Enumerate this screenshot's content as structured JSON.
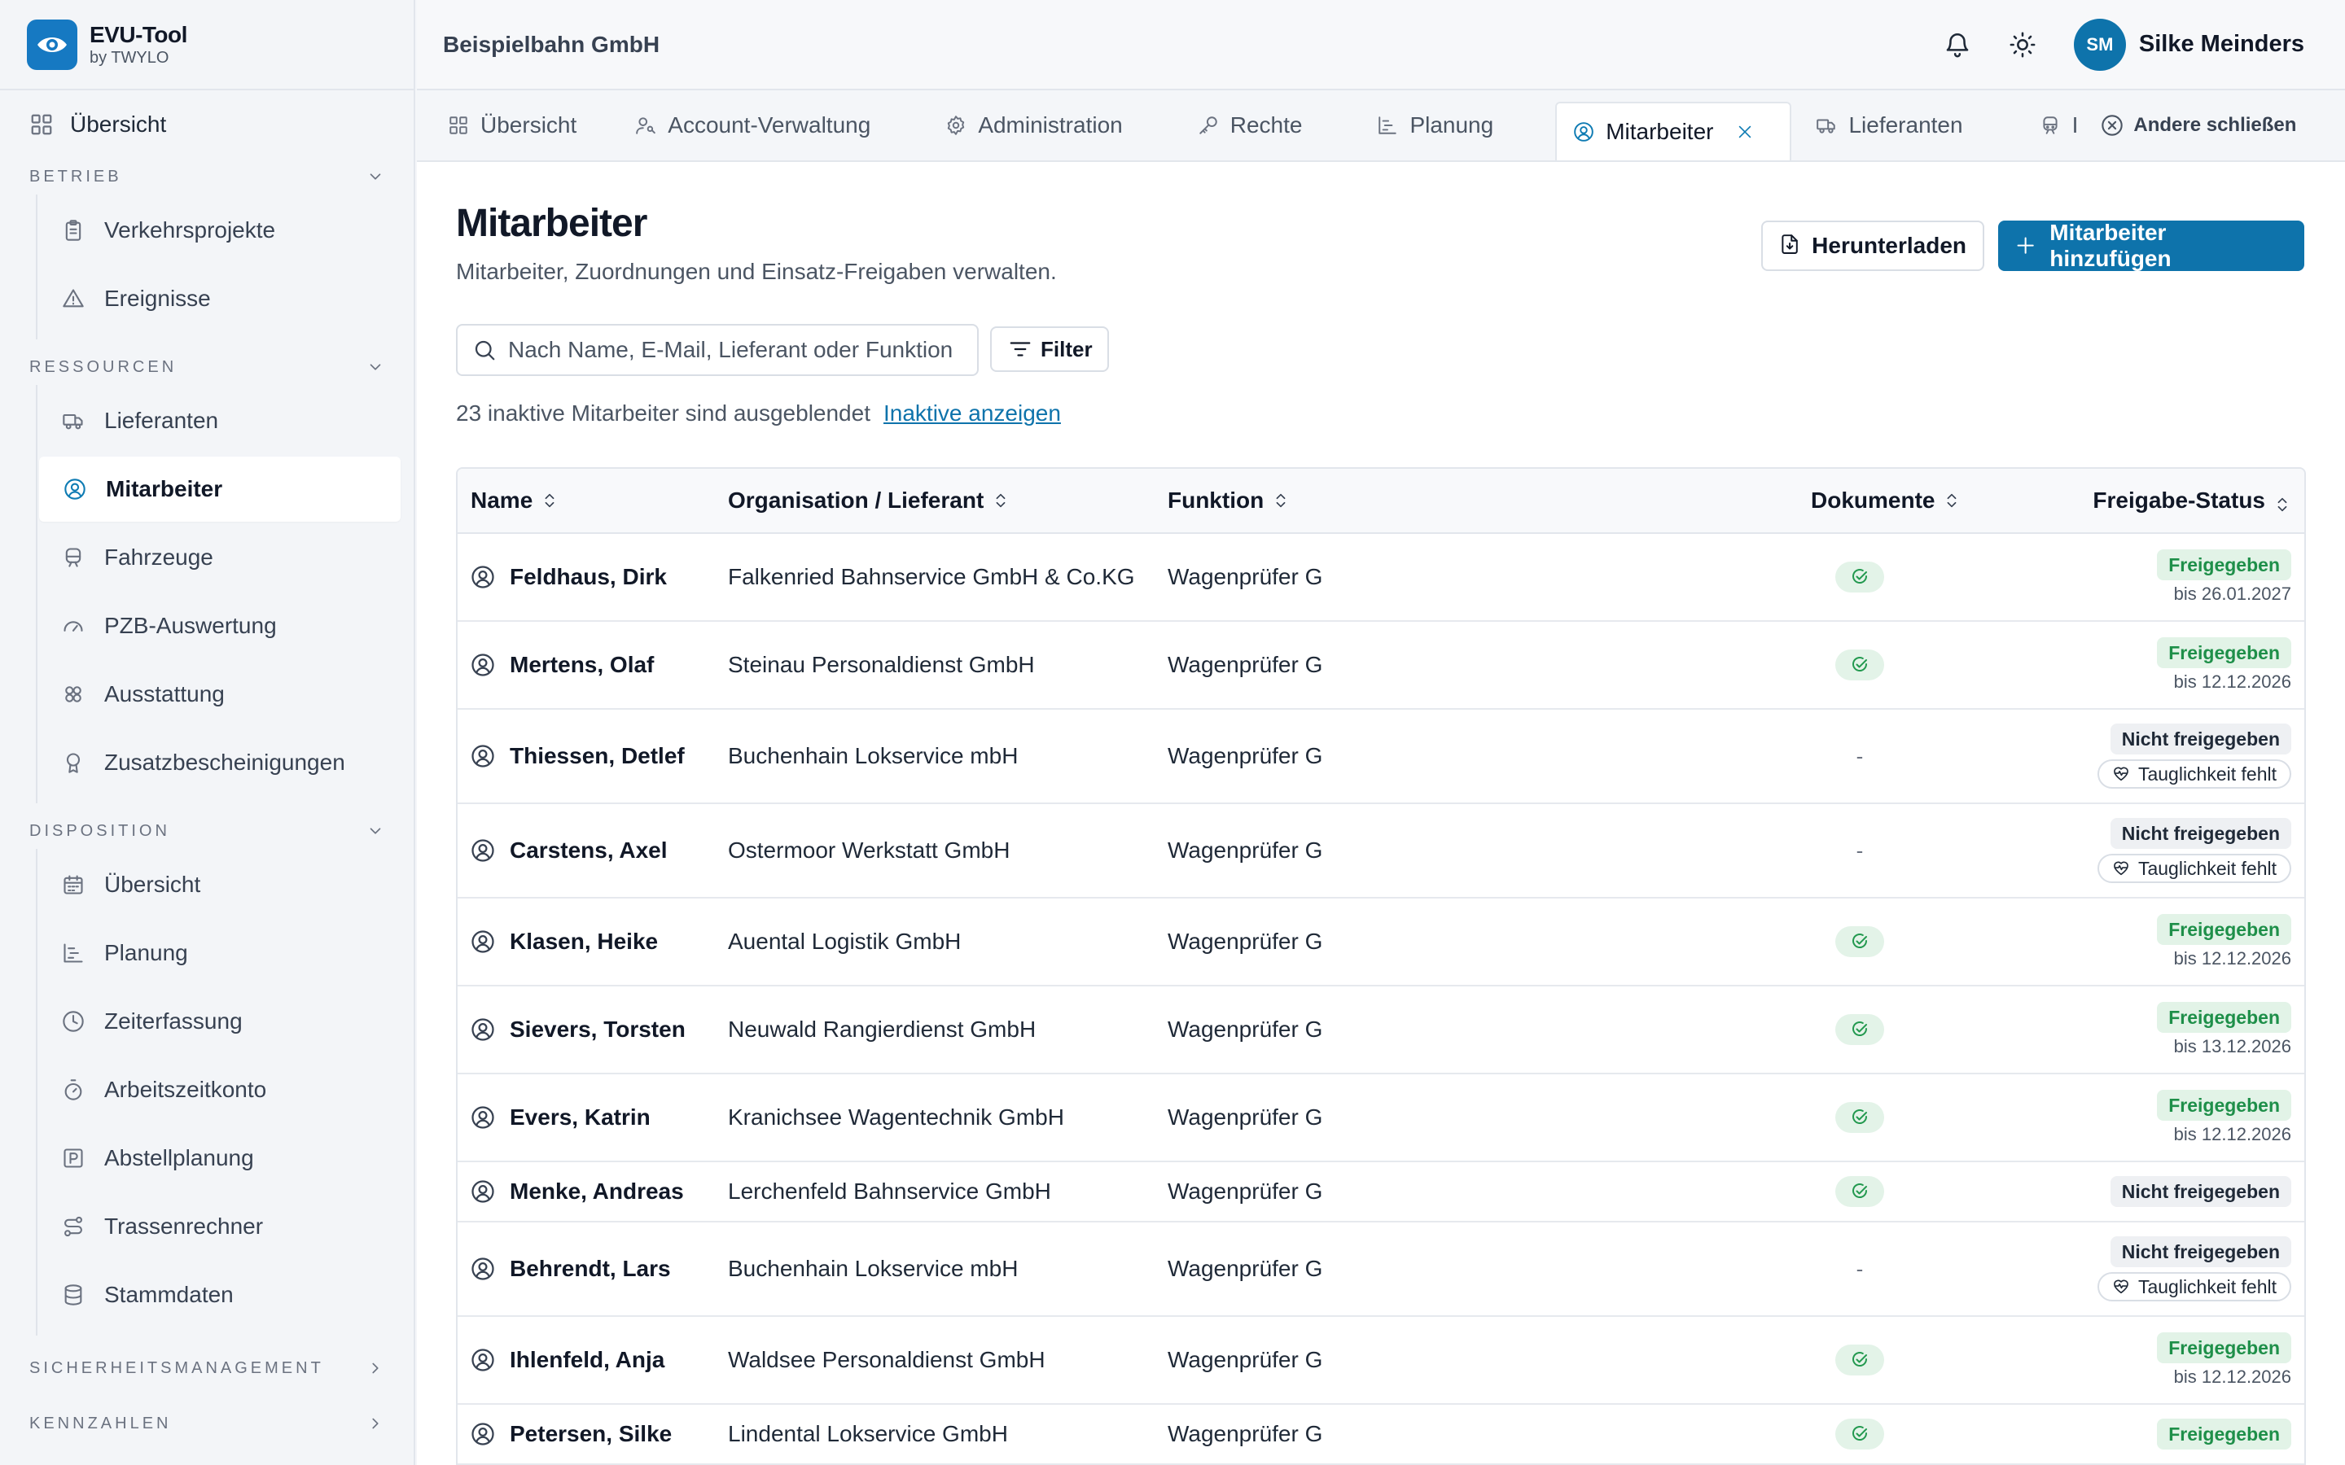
{
  "brand": {
    "name": "EVU-Tool",
    "sub": "by TWYLO"
  },
  "header": {
    "company": "Beispielbahn GmbH",
    "user_initials": "SM",
    "user_name": "Silke Meinders"
  },
  "sidebar": {
    "top": {
      "label": "Übersicht"
    },
    "sections": [
      {
        "title": "Betrieb",
        "items": [
          {
            "label": "Verkehrsprojekte",
            "icon": "clipboard-icon"
          },
          {
            "label": "Ereignisse",
            "icon": "warning-icon"
          }
        ]
      },
      {
        "title": "Ressourcen",
        "items": [
          {
            "label": "Lieferanten",
            "icon": "truck-icon"
          },
          {
            "label": "Mitarbeiter",
            "icon": "user-circle-icon"
          },
          {
            "label": "Fahrzeuge",
            "icon": "train-icon"
          },
          {
            "label": "PZB-Auswertung",
            "icon": "gauge-icon"
          },
          {
            "label": "Ausstattung",
            "icon": "boxes-icon"
          },
          {
            "label": "Zusatzbescheinigungen",
            "icon": "award-icon"
          }
        ]
      },
      {
        "title": "Disposition",
        "items": [
          {
            "label": "Übersicht",
            "icon": "calendar-icon"
          },
          {
            "label": "Planung",
            "icon": "chart-gantt-icon"
          },
          {
            "label": "Zeiterfassung",
            "icon": "clock-icon"
          },
          {
            "label": "Arbeitszeitkonto",
            "icon": "timer-icon"
          },
          {
            "label": "Abstellplanung",
            "icon": "parking-icon"
          },
          {
            "label": "Trassenrechner",
            "icon": "route-icon"
          },
          {
            "label": "Stammdaten",
            "icon": "database-icon"
          }
        ]
      },
      {
        "title": "Sicherheitsmanagement"
      },
      {
        "title": "Kennzahlen"
      }
    ]
  },
  "tabs": [
    {
      "label": "Übersicht"
    },
    {
      "label": "Account-Verwaltung"
    },
    {
      "label": "Administration"
    },
    {
      "label": "Rechte"
    },
    {
      "label": "Planung"
    },
    {
      "label": "Mitarbeiter"
    },
    {
      "label": "Lieferanten"
    },
    {
      "label": "I"
    }
  ],
  "close_others": "Andere schließen",
  "page": {
    "title": "Mitarbeiter",
    "subtitle": "Mitarbeiter, Zuordnungen und Einsatz-Freigaben verwalten.",
    "download_label": "Herunterladen",
    "add_label": "Mitarbeiter hinzufügen",
    "search_placeholder": "Nach Name, E-Mail, Lieferant oder Funktion",
    "filter_label": "Filter",
    "inactive_text": "23 inaktive Mitarbeiter sind ausgeblendet",
    "inactive_link": "Inaktive anzeigen"
  },
  "table": {
    "columns": [
      "Name",
      "Organisation / Lieferant",
      "Funktion",
      "Dokumente",
      "Freigabe-Status"
    ],
    "rows": [
      {
        "name": "Feldhaus, Dirk",
        "org": "Falkenried Bahnservice GmbH & Co.KG",
        "function": "Wagenprüfer G",
        "docs": true,
        "status": "Freigegeben",
        "until": "bis 26.01.2027"
      },
      {
        "name": "Mertens, Olaf",
        "org": "Steinau Personaldienst GmbH",
        "function": "Wagenprüfer G",
        "docs": true,
        "status": "Freigegeben",
        "until": "bis 12.12.2026"
      },
      {
        "name": "Thiessen, Detlef",
        "org": "Buchenhain Lokservice mbH",
        "function": "Wagenprüfer G",
        "docs": false,
        "status": "Nicht freigegeben",
        "missing": "Tauglichkeit fehlt"
      },
      {
        "name": "Carstens, Axel",
        "org": "Ostermoor Werkstatt GmbH",
        "function": "Wagenprüfer G",
        "docs": false,
        "status": "Nicht freigegeben",
        "missing": "Tauglichkeit fehlt"
      },
      {
        "name": "Klasen, Heike",
        "org": "Auental Logistik GmbH",
        "function": "Wagenprüfer G",
        "docs": true,
        "status": "Freigegeben",
        "until": "bis 12.12.2026"
      },
      {
        "name": "Sievers, Torsten",
        "org": "Neuwald Rangierdienst GmbH",
        "function": "Wagenprüfer G",
        "docs": true,
        "status": "Freigegeben",
        "until": "bis 13.12.2026"
      },
      {
        "name": "Evers, Katrin",
        "org": "Kranichsee Wagentechnik GmbH",
        "function": "Wagenprüfer G",
        "docs": true,
        "status": "Freigegeben",
        "until": "bis 12.12.2026"
      },
      {
        "name": "Menke, Andreas",
        "org": "Lerchenfeld Bahnservice GmbH",
        "function": "Wagenprüfer G",
        "docs": true,
        "status": "Nicht freigegeben"
      },
      {
        "name": "Behrendt, Lars",
        "org": "Buchenhain Lokservice mbH",
        "function": "Wagenprüfer G",
        "docs": false,
        "status": "Nicht freigegeben",
        "missing": "Tauglichkeit fehlt"
      },
      {
        "name": "Ihlenfeld, Anja",
        "org": "Waldsee Personaldienst GmbH",
        "function": "Wagenprüfer G",
        "docs": true,
        "status": "Freigegeben",
        "until": "bis 12.12.2026"
      },
      {
        "name": "Petersen, Silke",
        "org": "Lindental Lokservice GmbH",
        "function": "Wagenprüfer G",
        "docs": true,
        "status": "Freigegeben"
      }
    ],
    "docs_none": "-"
  },
  "colors": {
    "accent": "#0e73ab",
    "ok_bg": "#e2f3e7",
    "ok_text": "#1e8f49",
    "neutral_bg": "#eef0f3"
  }
}
